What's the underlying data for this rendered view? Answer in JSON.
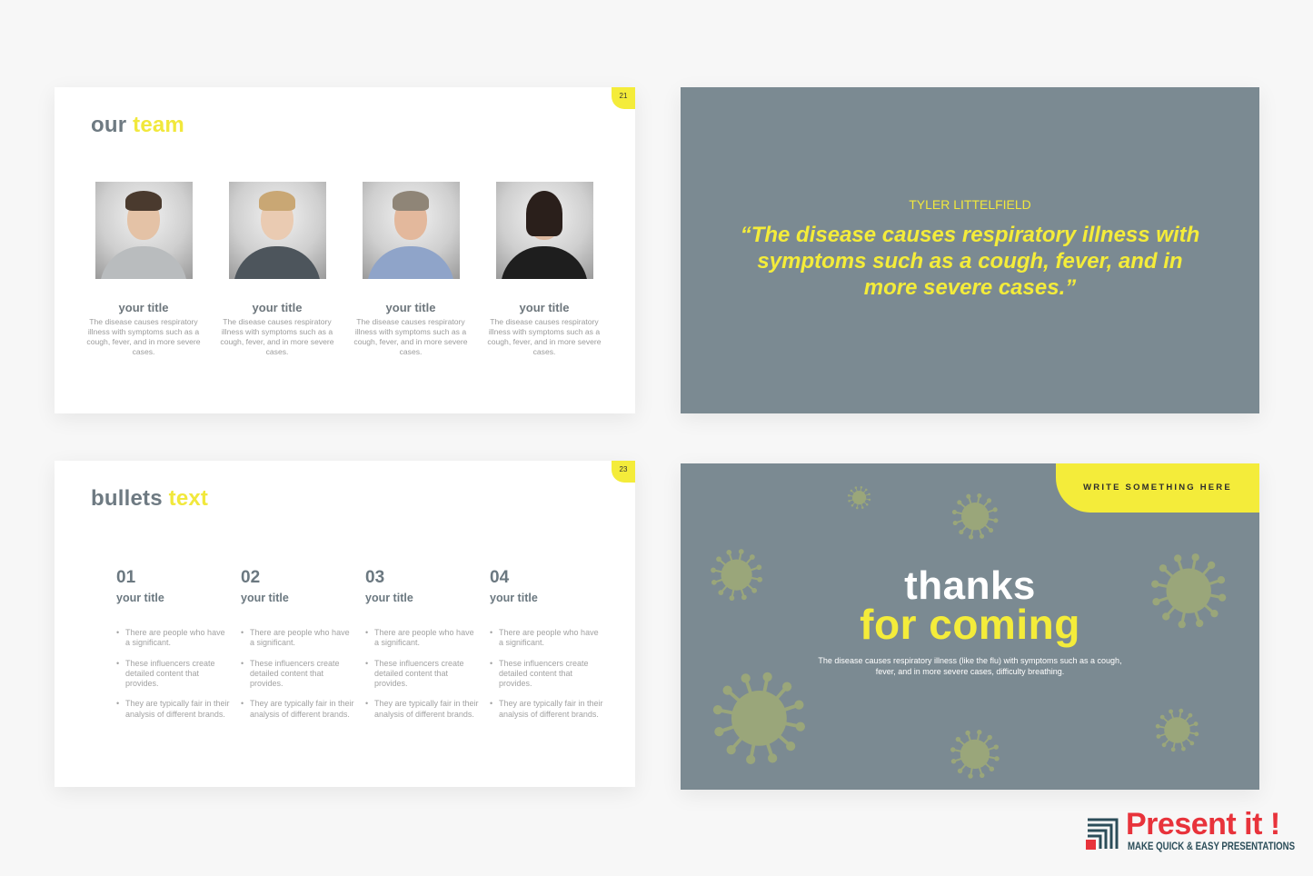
{
  "colors": {
    "accent_yellow": "#f4ec3a",
    "slate_grey": "#7b8a92",
    "virus_green": "#9aa67a",
    "title_grey": "#6e7a82",
    "logo_red": "#e8333b",
    "logo_navy": "#2b4d59"
  },
  "slide_team": {
    "page_number": "21",
    "title_part1": "our",
    "title_part2": "team",
    "members": [
      {
        "photo": "man-grey-shirt-photo",
        "title": "your title",
        "description": "The disease causes respiratory illness with symptoms such as a cough, fever, and in more severe cases."
      },
      {
        "photo": "woman-blonde-cardigan-photo",
        "title": "your title",
        "description": "The disease causes respiratory illness with symptoms such as a cough, fever, and in more severe cases."
      },
      {
        "photo": "man-blue-checked-shirt-photo",
        "title": "your title",
        "description": "The disease causes respiratory illness with symptoms such as a cough, fever, and in more severe cases."
      },
      {
        "photo": "woman-dark-hair-blazer-photo",
        "title": "your title",
        "description": "The disease causes respiratory illness with symptoms such as a cough, fever, and in more severe cases."
      }
    ]
  },
  "slide_quote": {
    "author": "TYLER LITTELFIELD",
    "quote": "“The disease causes respiratory illness with symptoms such as a cough, fever, and in more severe cases.”"
  },
  "slide_bullets": {
    "page_number": "23",
    "title_part1": "bullets",
    "title_part2": "text",
    "columns": [
      {
        "number": "01",
        "title": "your title",
        "bullets": [
          "There are people who have a significant.",
          "These influencers create detailed content that provides.",
          "They are typically fair in their analysis of different brands."
        ]
      },
      {
        "number": "02",
        "title": "your title",
        "bullets": [
          "There are people who have a significant.",
          "These influencers create detailed content that provides.",
          "They are typically fair in their analysis of different brands."
        ]
      },
      {
        "number": "03",
        "title": "your title",
        "bullets": [
          "There are people who have a significant.",
          "These influencers create detailed content that provides.",
          "They are typically fair in their analysis of different brands."
        ]
      },
      {
        "number": "04",
        "title": "your title",
        "bullets": [
          "There are people who have a significant.",
          "These influencers create detailed content that provides.",
          "They are typically fair in their analysis of different brands."
        ]
      }
    ]
  },
  "slide_thanks": {
    "tag": "WRITE SOMETHING HERE",
    "line1": "thanks",
    "line2": "for coming",
    "description": "The disease causes respiratory illness (like the flu) with symptoms such as a cough, fever, and in more severe cases, difficulty breathing.",
    "virus_icon": "virus-icon"
  },
  "watermark": {
    "name": "Present it !",
    "tagline": "MAKE QUICK & EASY PRESENTATIONS"
  }
}
